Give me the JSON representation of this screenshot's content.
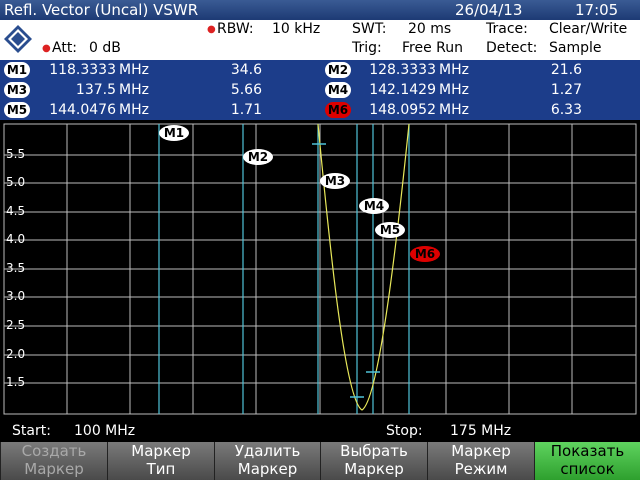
{
  "header": {
    "title": "Refl. Vector (Uncal) VSWR",
    "date": "26/04/13",
    "time": "17:05"
  },
  "settings": {
    "rbw_label": "RBW:",
    "rbw_value": "10 kHz",
    "swt_label": "SWT:",
    "swt_value": "20 ms",
    "trace_label": "Trace:",
    "trace_value": "Clear/Write",
    "att_label": "Att:",
    "att_value": "0 dB",
    "trig_label": "Trig:",
    "trig_value": "Free Run",
    "detect_label": "Detect:",
    "detect_value": "Sample"
  },
  "markers": [
    {
      "id": "M1",
      "freq": "118.3333",
      "unit": "MHz",
      "value": "34.6"
    },
    {
      "id": "M2",
      "freq": "128.3333",
      "unit": "MHz",
      "value": "21.6"
    },
    {
      "id": "M3",
      "freq": "137.5",
      "unit": "MHz",
      "value": "5.66"
    },
    {
      "id": "M4",
      "freq": "142.1429",
      "unit": "MHz",
      "value": "1.27"
    },
    {
      "id": "M5",
      "freq": "144.0476",
      "unit": "MHz",
      "value": "1.71"
    },
    {
      "id": "M6",
      "freq": "148.0952",
      "unit": "MHz",
      "value": "6.33",
      "active": true
    }
  ],
  "plot": {
    "y_ticks": [
      "5.5",
      "5.0",
      "4.5",
      "4.0",
      "3.5",
      "3.0",
      "2.5",
      "2.0",
      "1.5"
    ],
    "marker_labels": [
      "M1",
      "M2",
      "M3",
      "M4",
      "M5",
      "M6"
    ],
    "trace_color": "#e8e85a",
    "marker_line_color": "#4fc3d9",
    "grid_color": "#bdbdbd"
  },
  "frequency": {
    "start_label": "Start:",
    "start_value": "100 MHz",
    "stop_label": "Stop:",
    "stop_value": "175 MHz"
  },
  "softkeys": [
    {
      "line1": "Создать",
      "line2": "Маркер",
      "disabled": true
    },
    {
      "line1": "Маркер",
      "line2": "Тип"
    },
    {
      "line1": "Удалить",
      "line2": "Маркер"
    },
    {
      "line1": "Выбрать",
      "line2": "Маркер"
    },
    {
      "line1": "Маркер",
      "line2": "Режим"
    },
    {
      "line1": "Показать",
      "line2": "список",
      "highlight": true
    }
  ]
}
